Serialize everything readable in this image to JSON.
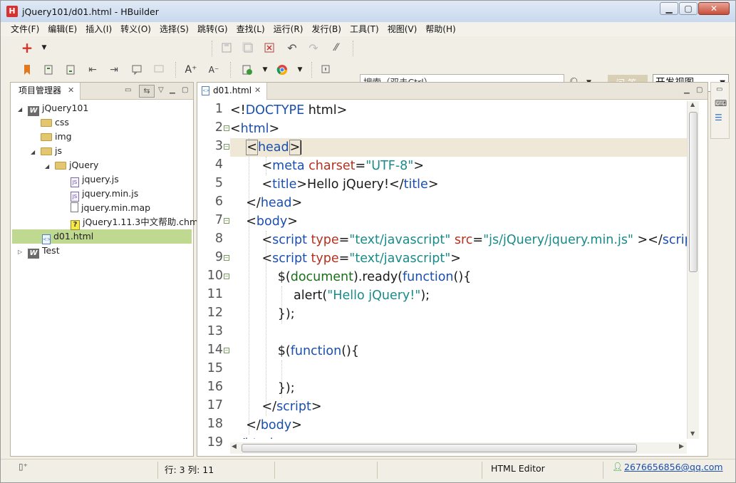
{
  "window": {
    "title": "jQuery101/d01.html  -  HBuilder",
    "app_icon": "H",
    "min": "▁",
    "max": "▢",
    "close": "✕"
  },
  "menu": [
    "文件(F)",
    "编辑(E)",
    "插入(I)",
    "转义(O)",
    "选择(S)",
    "跳转(G)",
    "查找(L)",
    "运行(R)",
    "发行(B)",
    "工具(T)",
    "视图(V)",
    "帮助(H)"
  ],
  "toolbar": {
    "search_placeholder": "搜索（双击Ctrl）",
    "ask_label": "问答",
    "view_mode": "开发视图"
  },
  "explorer": {
    "tab_label": "项目管理器",
    "tree": [
      {
        "label": "jQuery101",
        "icon": "project-icon",
        "expanded": true
      },
      {
        "label": "css",
        "icon": "folder-icon"
      },
      {
        "label": "img",
        "icon": "folder-icon"
      },
      {
        "label": "js",
        "icon": "folder-icon",
        "expanded": true
      },
      {
        "label": "jQuery",
        "icon": "folder-icon",
        "expanded": true
      },
      {
        "label": "jquery.js",
        "icon": "js-file-icon"
      },
      {
        "label": "jquery.min.js",
        "icon": "js-file-icon"
      },
      {
        "label": "jquery.min.map",
        "icon": "file-icon"
      },
      {
        "label": "jQuery1.11.3中文帮助.chm",
        "icon": "help-file-icon"
      },
      {
        "label": "d01.html",
        "icon": "html-file-icon",
        "selected": true
      },
      {
        "label": "Test",
        "icon": "project-icon",
        "expanded": false
      }
    ]
  },
  "editor": {
    "tab_label": "d01.html",
    "current_line": 3,
    "line_numbers": [
      "1",
      "2",
      "3",
      "4",
      "5",
      "6",
      "7",
      "8",
      "9",
      "10",
      "11",
      "12",
      "13",
      "14",
      "15",
      "16",
      "17",
      "18",
      "19"
    ]
  },
  "status": {
    "position": "行: 3 列: 11",
    "editor_type": "HTML Editor",
    "user": "2676656856@qq.com"
  },
  "colors": {
    "tag": "#1b4fae",
    "attribute": "#b4311f",
    "string": "#1a8a8a",
    "selection": "#bfd990",
    "current_line": "#efe8d6"
  }
}
